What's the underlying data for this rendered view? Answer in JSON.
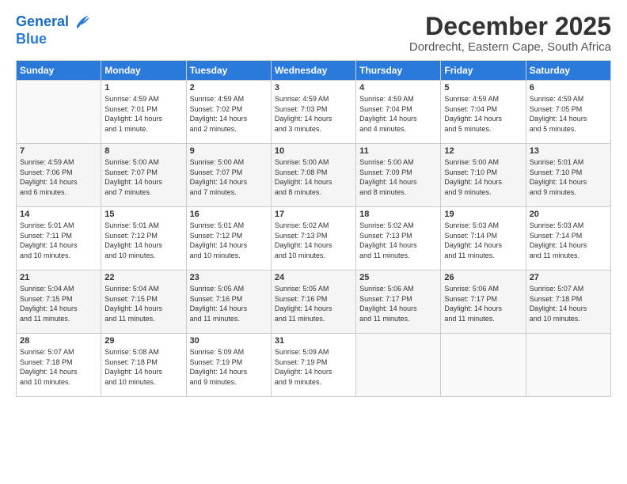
{
  "logo": {
    "line1": "General",
    "line2": "Blue"
  },
  "title": "December 2025",
  "subtitle": "Dordrecht, Eastern Cape, South Africa",
  "headers": [
    "Sunday",
    "Monday",
    "Tuesday",
    "Wednesday",
    "Thursday",
    "Friday",
    "Saturday"
  ],
  "weeks": [
    [
      {
        "day": "",
        "info": ""
      },
      {
        "day": "1",
        "info": "Sunrise: 4:59 AM\nSunset: 7:01 PM\nDaylight: 14 hours\nand 1 minute."
      },
      {
        "day": "2",
        "info": "Sunrise: 4:59 AM\nSunset: 7:02 PM\nDaylight: 14 hours\nand 2 minutes."
      },
      {
        "day": "3",
        "info": "Sunrise: 4:59 AM\nSunset: 7:03 PM\nDaylight: 14 hours\nand 3 minutes."
      },
      {
        "day": "4",
        "info": "Sunrise: 4:59 AM\nSunset: 7:04 PM\nDaylight: 14 hours\nand 4 minutes."
      },
      {
        "day": "5",
        "info": "Sunrise: 4:59 AM\nSunset: 7:04 PM\nDaylight: 14 hours\nand 5 minutes."
      },
      {
        "day": "6",
        "info": "Sunrise: 4:59 AM\nSunset: 7:05 PM\nDaylight: 14 hours\nand 5 minutes."
      }
    ],
    [
      {
        "day": "7",
        "info": "Sunrise: 4:59 AM\nSunset: 7:06 PM\nDaylight: 14 hours\nand 6 minutes."
      },
      {
        "day": "8",
        "info": "Sunrise: 5:00 AM\nSunset: 7:07 PM\nDaylight: 14 hours\nand 7 minutes."
      },
      {
        "day": "9",
        "info": "Sunrise: 5:00 AM\nSunset: 7:07 PM\nDaylight: 14 hours\nand 7 minutes."
      },
      {
        "day": "10",
        "info": "Sunrise: 5:00 AM\nSunset: 7:08 PM\nDaylight: 14 hours\nand 8 minutes."
      },
      {
        "day": "11",
        "info": "Sunrise: 5:00 AM\nSunset: 7:09 PM\nDaylight: 14 hours\nand 8 minutes."
      },
      {
        "day": "12",
        "info": "Sunrise: 5:00 AM\nSunset: 7:10 PM\nDaylight: 14 hours\nand 9 minutes."
      },
      {
        "day": "13",
        "info": "Sunrise: 5:01 AM\nSunset: 7:10 PM\nDaylight: 14 hours\nand 9 minutes."
      }
    ],
    [
      {
        "day": "14",
        "info": "Sunrise: 5:01 AM\nSunset: 7:11 PM\nDaylight: 14 hours\nand 10 minutes."
      },
      {
        "day": "15",
        "info": "Sunrise: 5:01 AM\nSunset: 7:12 PM\nDaylight: 14 hours\nand 10 minutes."
      },
      {
        "day": "16",
        "info": "Sunrise: 5:01 AM\nSunset: 7:12 PM\nDaylight: 14 hours\nand 10 minutes."
      },
      {
        "day": "17",
        "info": "Sunrise: 5:02 AM\nSunset: 7:13 PM\nDaylight: 14 hours\nand 10 minutes."
      },
      {
        "day": "18",
        "info": "Sunrise: 5:02 AM\nSunset: 7:13 PM\nDaylight: 14 hours\nand 11 minutes."
      },
      {
        "day": "19",
        "info": "Sunrise: 5:03 AM\nSunset: 7:14 PM\nDaylight: 14 hours\nand 11 minutes."
      },
      {
        "day": "20",
        "info": "Sunrise: 5:03 AM\nSunset: 7:14 PM\nDaylight: 14 hours\nand 11 minutes."
      }
    ],
    [
      {
        "day": "21",
        "info": "Sunrise: 5:04 AM\nSunset: 7:15 PM\nDaylight: 14 hours\nand 11 minutes."
      },
      {
        "day": "22",
        "info": "Sunrise: 5:04 AM\nSunset: 7:15 PM\nDaylight: 14 hours\nand 11 minutes."
      },
      {
        "day": "23",
        "info": "Sunrise: 5:05 AM\nSunset: 7:16 PM\nDaylight: 14 hours\nand 11 minutes."
      },
      {
        "day": "24",
        "info": "Sunrise: 5:05 AM\nSunset: 7:16 PM\nDaylight: 14 hours\nand 11 minutes."
      },
      {
        "day": "25",
        "info": "Sunrise: 5:06 AM\nSunset: 7:17 PM\nDaylight: 14 hours\nand 11 minutes."
      },
      {
        "day": "26",
        "info": "Sunrise: 5:06 AM\nSunset: 7:17 PM\nDaylight: 14 hours\nand 11 minutes."
      },
      {
        "day": "27",
        "info": "Sunrise: 5:07 AM\nSunset: 7:18 PM\nDaylight: 14 hours\nand 10 minutes."
      }
    ],
    [
      {
        "day": "28",
        "info": "Sunrise: 5:07 AM\nSunset: 7:18 PM\nDaylight: 14 hours\nand 10 minutes."
      },
      {
        "day": "29",
        "info": "Sunrise: 5:08 AM\nSunset: 7:18 PM\nDaylight: 14 hours\nand 10 minutes."
      },
      {
        "day": "30",
        "info": "Sunrise: 5:09 AM\nSunset: 7:19 PM\nDaylight: 14 hours\nand 9 minutes."
      },
      {
        "day": "31",
        "info": "Sunrise: 5:09 AM\nSunset: 7:19 PM\nDaylight: 14 hours\nand 9 minutes."
      },
      {
        "day": "",
        "info": ""
      },
      {
        "day": "",
        "info": ""
      },
      {
        "day": "",
        "info": ""
      }
    ]
  ]
}
